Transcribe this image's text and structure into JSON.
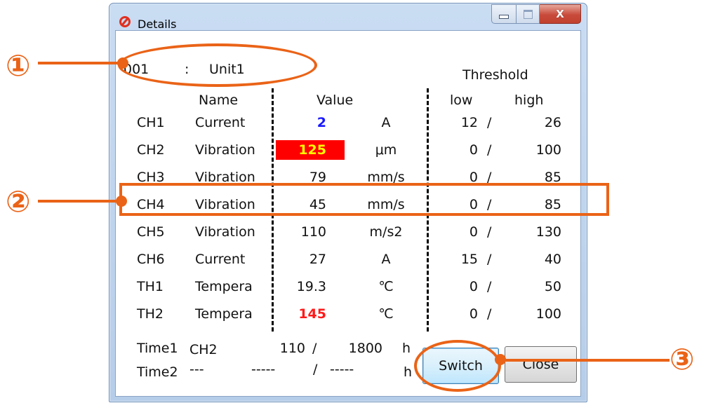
{
  "window": {
    "title": "Details"
  },
  "unit": {
    "id": "001",
    "separator": ":",
    "name": "Unit1"
  },
  "threshold_label": "Threshold",
  "headers": {
    "name": "Name",
    "value": "Value",
    "low": "low",
    "high": "high"
  },
  "rows": [
    {
      "ch": "CH1",
      "name": "Current",
      "value": "2",
      "unit": "A",
      "low": "12",
      "sep": "/",
      "high": "26",
      "value_color": "#1a1aff"
    },
    {
      "ch": "CH2",
      "name": "Vibration",
      "value": "125",
      "unit": "μm",
      "low": "0",
      "sep": "/",
      "high": "100",
      "value_color": "#ffff00",
      "value_bg": "#ff0000"
    },
    {
      "ch": "CH3",
      "name": "Vibration",
      "value": "79",
      "unit": "mm/s",
      "low": "0",
      "sep": "/",
      "high": "85"
    },
    {
      "ch": "CH4",
      "name": "Vibration",
      "value": "45",
      "unit": "mm/s",
      "low": "0",
      "sep": "/",
      "high": "85"
    },
    {
      "ch": "CH5",
      "name": "Vibration",
      "value": "110",
      "unit": "m/s2",
      "low": "0",
      "sep": "/",
      "high": "130"
    },
    {
      "ch": "CH6",
      "name": "Current",
      "value": "27",
      "unit": "A",
      "low": "15",
      "sep": "/",
      "high": "40"
    },
    {
      "ch": "TH1",
      "name": "Tempera",
      "value": "19.3",
      "unit": "℃",
      "low": "0",
      "sep": "/",
      "high": "50"
    },
    {
      "ch": "TH2",
      "name": "Tempera",
      "value": "145",
      "unit": "℃",
      "low": "0",
      "sep": "/",
      "high": "100",
      "value_color": "#ff1a1a"
    }
  ],
  "time": [
    {
      "label": "Time1",
      "ch": "CH2",
      "current": "110",
      "sep": "/",
      "limit": "1800",
      "unit": "h"
    },
    {
      "label": "Time2",
      "ch": "---",
      "current": "-----",
      "sep": "/",
      "limit": "-----",
      "unit": "h"
    }
  ],
  "buttons": {
    "switch": "Switch",
    "close": "Close"
  },
  "annotations": {
    "one": "①",
    "two": "②",
    "three": "③",
    "color": "#ea6317"
  }
}
